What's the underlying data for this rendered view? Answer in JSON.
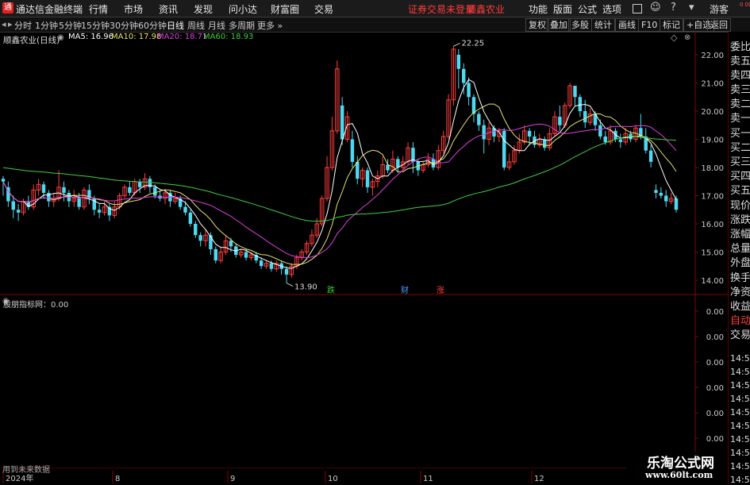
{
  "menubar": {
    "app_title": "通达信金融终端",
    "items": [
      "行情",
      "市场",
      "资讯",
      "发现",
      "问小达",
      "财富圈",
      "交易"
    ],
    "notice": "证券交易未登录",
    "stock_name": "顺鑫农业",
    "right_items": [
      "功能",
      "版面",
      "公式",
      "选项",
      "游客"
    ]
  },
  "periods": [
    "分时",
    "1分钟",
    "5分钟",
    "15分钟",
    "30分钟",
    "60分钟",
    "日线",
    "周线",
    "月线",
    "多周期",
    "更多"
  ],
  "active_period": "日线",
  "tools": [
    "复权",
    "叠加",
    "多股",
    "统计",
    "画线",
    "F10",
    "标记",
    "+自选",
    "返回"
  ],
  "chart_title": "顺鑫农业(日线)",
  "ma_legend": [
    {
      "label": "MA5: 16.96",
      "color": "#ffffff"
    },
    {
      "label": "MA10: 17.98",
      "color": "#e8e36a"
    },
    {
      "label": "MA20: 18.71",
      "color": "#e040e0"
    },
    {
      "label": "MA60: 18.93",
      "color": "#40d040"
    }
  ],
  "indicator_label": "股朋指标网：0.00",
  "bottom_text": "用到未来数据",
  "side_panel": {
    "items": [
      "委比",
      "卖五",
      "卖四",
      "卖三",
      "卖二",
      "卖一",
      "买一",
      "买二",
      "买三",
      "买四",
      "买五",
      "现价",
      "涨跌",
      "涨幅",
      "总量",
      "外盘",
      "换手",
      "净资",
      "收益",
      "自动",
      "交易"
    ],
    "times": [
      "14:5",
      "14:5",
      "14:5",
      "14:5",
      "14:5",
      "14:5",
      "14:5",
      "14:5",
      "14:5",
      "14:5"
    ],
    "top_fragment": "0\n000"
  },
  "watermark": {
    "line1": "乐淘公式网",
    "line2": "www.60lt.com"
  },
  "chart_data": {
    "type": "candlestick",
    "yaxis": {
      "min": 13.5,
      "max": 22.5,
      "ticks": [
        22.0,
        21.0,
        20.0,
        19.0,
        18.0,
        17.0,
        16.0,
        15.0,
        14.0
      ]
    },
    "indicator_axis": {
      "ticks": [
        "0.00",
        "0.00",
        "0.00",
        "0.00",
        "0.00",
        "0.00"
      ]
    },
    "x_labels": [
      "2024年",
      "8",
      "9",
      "10",
      "11",
      "12"
    ],
    "annotations": [
      {
        "text": "22.25",
        "type": "high"
      },
      {
        "text": "13.90",
        "type": "low"
      }
    ],
    "markers": [
      {
        "text": "跌",
        "color": "#30d030"
      },
      {
        "text": "财",
        "color": "#40a0ff"
      },
      {
        "text": "涨",
        "color": "#ff4040"
      }
    ],
    "candles": [
      [
        17.6,
        17.5,
        17.7,
        17.0
      ],
      [
        17.3,
        16.8,
        17.5,
        16.6
      ],
      [
        16.8,
        16.5,
        17.0,
        16.2
      ],
      [
        16.5,
        16.4,
        16.7,
        16.1
      ],
      [
        16.4,
        16.8,
        16.9,
        16.3
      ],
      [
        16.8,
        16.6,
        17.0,
        16.5
      ],
      [
        16.6,
        17.2,
        17.4,
        16.5
      ],
      [
        17.2,
        17.4,
        17.6,
        17.0
      ],
      [
        17.4,
        17.1,
        17.5,
        16.9
      ],
      [
        17.1,
        16.8,
        17.2,
        16.6
      ],
      [
        16.8,
        16.9,
        17.1,
        16.6
      ],
      [
        16.9,
        17.3,
        17.9,
        16.8
      ],
      [
        17.3,
        17.1,
        17.5,
        16.8
      ],
      [
        17.1,
        16.8,
        17.2,
        16.6
      ],
      [
        16.8,
        16.9,
        17.2,
        16.6
      ],
      [
        16.9,
        16.6,
        17.1,
        16.5
      ],
      [
        16.6,
        17.2,
        17.3,
        16.5
      ],
      [
        17.2,
        16.9,
        17.4,
        16.7
      ],
      [
        16.9,
        16.5,
        17.0,
        16.3
      ],
      [
        16.5,
        16.4,
        16.7,
        16.2
      ],
      [
        16.4,
        16.6,
        16.8,
        16.3
      ],
      [
        16.6,
        16.3,
        16.7,
        16.1
      ],
      [
        16.3,
        16.6,
        16.8,
        16.2
      ],
      [
        16.6,
        17.0,
        17.1,
        16.5
      ],
      [
        17.0,
        17.3,
        17.4,
        16.9
      ],
      [
        17.3,
        17.1,
        17.5,
        17.0
      ],
      [
        17.1,
        17.5,
        17.6,
        17.0
      ],
      [
        17.5,
        17.3,
        17.6,
        17.1
      ],
      [
        17.3,
        17.6,
        17.8,
        17.2
      ],
      [
        17.6,
        17.3,
        17.7,
        17.1
      ],
      [
        17.3,
        17.0,
        17.4,
        16.9
      ],
      [
        17.0,
        16.9,
        17.2,
        16.8
      ],
      [
        16.9,
        17.1,
        17.2,
        16.7
      ],
      [
        17.1,
        16.8,
        17.2,
        16.6
      ],
      [
        16.8,
        16.9,
        17.1,
        16.7
      ],
      [
        16.9,
        16.6,
        17.0,
        16.5
      ],
      [
        16.6,
        16.4,
        16.8,
        16.3
      ],
      [
        16.4,
        16.0,
        16.5,
        15.9
      ],
      [
        16.0,
        15.6,
        16.1,
        15.5
      ],
      [
        15.6,
        15.4,
        15.7,
        15.2
      ],
      [
        15.4,
        15.6,
        15.8,
        15.2
      ],
      [
        15.6,
        15.1,
        15.7,
        14.9
      ],
      [
        15.1,
        14.7,
        15.2,
        14.6
      ],
      [
        14.7,
        15.0,
        15.2,
        14.6
      ],
      [
        15.0,
        15.4,
        15.6,
        14.9
      ],
      [
        15.4,
        15.2,
        15.5,
        15.0
      ],
      [
        15.2,
        14.9,
        15.3,
        14.8
      ],
      [
        14.9,
        15.0,
        15.1,
        14.8
      ],
      [
        15.0,
        14.8,
        15.1,
        14.7
      ],
      [
        14.8,
        14.9,
        15.0,
        14.7
      ],
      [
        14.9,
        14.7,
        15.0,
        14.6
      ],
      [
        14.7,
        14.5,
        14.8,
        14.4
      ],
      [
        14.5,
        14.6,
        14.7,
        14.4
      ],
      [
        14.6,
        14.4,
        14.7,
        14.3
      ],
      [
        14.4,
        14.6,
        14.7,
        14.3
      ],
      [
        14.6,
        14.4,
        14.7,
        14.2
      ],
      [
        14.4,
        14.2,
        14.5,
        13.9
      ],
      [
        14.2,
        14.5,
        14.6,
        14.1
      ],
      [
        14.5,
        14.8,
        14.9,
        14.4
      ],
      [
        14.8,
        15.0,
        15.1,
        14.7
      ],
      [
        15.0,
        15.3,
        15.4,
        14.9
      ],
      [
        15.3,
        15.6,
        15.8,
        15.2
      ],
      [
        15.6,
        16.0,
        16.2,
        15.5
      ],
      [
        16.0,
        16.9,
        17.0,
        15.9
      ],
      [
        16.9,
        18.0,
        18.4,
        16.8
      ],
      [
        18.0,
        19.3,
        19.8,
        17.9
      ],
      [
        19.3,
        21.5,
        21.8,
        19.2
      ],
      [
        20.2,
        19.0,
        20.5,
        18.8
      ],
      [
        19.0,
        19.8,
        20.0,
        18.9
      ],
      [
        19.0,
        18.2,
        19.3,
        18.0
      ],
      [
        18.2,
        17.6,
        18.4,
        17.4
      ],
      [
        17.6,
        17.9,
        18.0,
        17.3
      ],
      [
        17.9,
        17.3,
        18.0,
        17.1
      ],
      [
        17.3,
        17.5,
        17.6,
        17.0
      ],
      [
        17.5,
        17.7,
        17.9,
        17.3
      ],
      [
        17.7,
        18.1,
        18.4,
        17.6
      ],
      [
        18.1,
        17.9,
        18.3,
        17.8
      ],
      [
        17.9,
        18.3,
        18.6,
        17.8
      ],
      [
        18.3,
        18.0,
        18.4,
        17.8
      ],
      [
        18.0,
        18.2,
        18.4,
        17.9
      ],
      [
        18.2,
        18.7,
        18.9,
        18.1
      ],
      [
        18.7,
        18.2,
        18.9,
        17.8
      ],
      [
        18.2,
        17.9,
        18.3,
        17.7
      ],
      [
        17.9,
        18.1,
        18.2,
        17.8
      ],
      [
        18.1,
        18.3,
        18.5,
        18.0
      ],
      [
        18.3,
        18.0,
        18.5,
        17.9
      ],
      [
        18.0,
        18.6,
        18.8,
        17.9
      ],
      [
        18.6,
        19.1,
        19.3,
        18.5
      ],
      [
        19.1,
        20.4,
        20.6,
        19.0
      ],
      [
        20.4,
        22.2,
        22.3,
        20.2
      ],
      [
        22.0,
        21.5,
        22.2,
        20.8
      ],
      [
        21.5,
        21.0,
        21.7,
        20.6
      ],
      [
        21.0,
        20.5,
        21.2,
        20.2
      ],
      [
        20.5,
        19.9,
        20.6,
        19.6
      ],
      [
        19.9,
        19.5,
        20.0,
        19.3
      ],
      [
        19.5,
        19.0,
        19.7,
        18.5
      ],
      [
        19.0,
        19.4,
        19.6,
        18.8
      ],
      [
        19.4,
        19.1,
        19.5,
        18.9
      ],
      [
        19.1,
        19.3,
        19.4,
        18.9
      ],
      [
        19.3,
        18.0,
        19.4,
        17.9
      ],
      [
        18.0,
        18.2,
        18.5,
        17.9
      ],
      [
        18.2,
        18.6,
        18.8,
        18.1
      ],
      [
        18.6,
        18.9,
        19.2,
        18.5
      ],
      [
        18.9,
        19.3,
        19.5,
        18.8
      ],
      [
        19.3,
        19.1,
        19.4,
        18.8
      ],
      [
        19.1,
        18.8,
        19.3,
        18.7
      ],
      [
        18.8,
        19.0,
        19.2,
        18.7
      ],
      [
        19.0,
        18.7,
        19.1,
        18.6
      ],
      [
        18.7,
        19.2,
        19.4,
        18.6
      ],
      [
        19.2,
        19.8,
        20.0,
        19.1
      ],
      [
        19.8,
        19.5,
        20.2,
        19.3
      ],
      [
        19.5,
        20.2,
        20.3,
        19.4
      ],
      [
        20.2,
        20.9,
        21.0,
        20.1
      ],
      [
        20.9,
        20.5,
        20.9,
        20.2
      ],
      [
        20.5,
        20.0,
        20.6,
        19.8
      ],
      [
        20.0,
        19.6,
        20.4,
        19.4
      ],
      [
        19.6,
        19.9,
        20.1,
        19.5
      ],
      [
        19.9,
        19.5,
        20.0,
        19.3
      ],
      [
        19.5,
        19.1,
        19.7,
        19.0
      ],
      [
        19.1,
        18.9,
        19.3,
        18.8
      ],
      [
        18.9,
        19.3,
        19.5,
        18.8
      ],
      [
        19.3,
        19.0,
        19.4,
        18.9
      ],
      [
        19.0,
        18.9,
        19.2,
        18.7
      ],
      [
        18.9,
        19.2,
        19.4,
        18.8
      ],
      [
        19.2,
        19.0,
        19.3,
        18.9
      ],
      [
        19.0,
        19.4,
        19.5,
        18.9
      ],
      [
        19.4,
        19.1,
        19.9,
        19.0
      ],
      [
        19.1,
        18.6,
        19.4,
        18.5
      ],
      [
        18.6,
        18.2,
        18.8,
        18.0
      ],
      [
        17.2,
        17.1,
        17.4,
        16.9
      ],
      [
        17.1,
        17.0,
        17.3,
        16.9
      ],
      [
        17.0,
        16.8,
        17.2,
        16.6
      ],
      [
        16.8,
        16.9,
        17.1,
        16.7
      ],
      [
        16.9,
        16.5,
        17.0,
        16.4
      ]
    ]
  }
}
